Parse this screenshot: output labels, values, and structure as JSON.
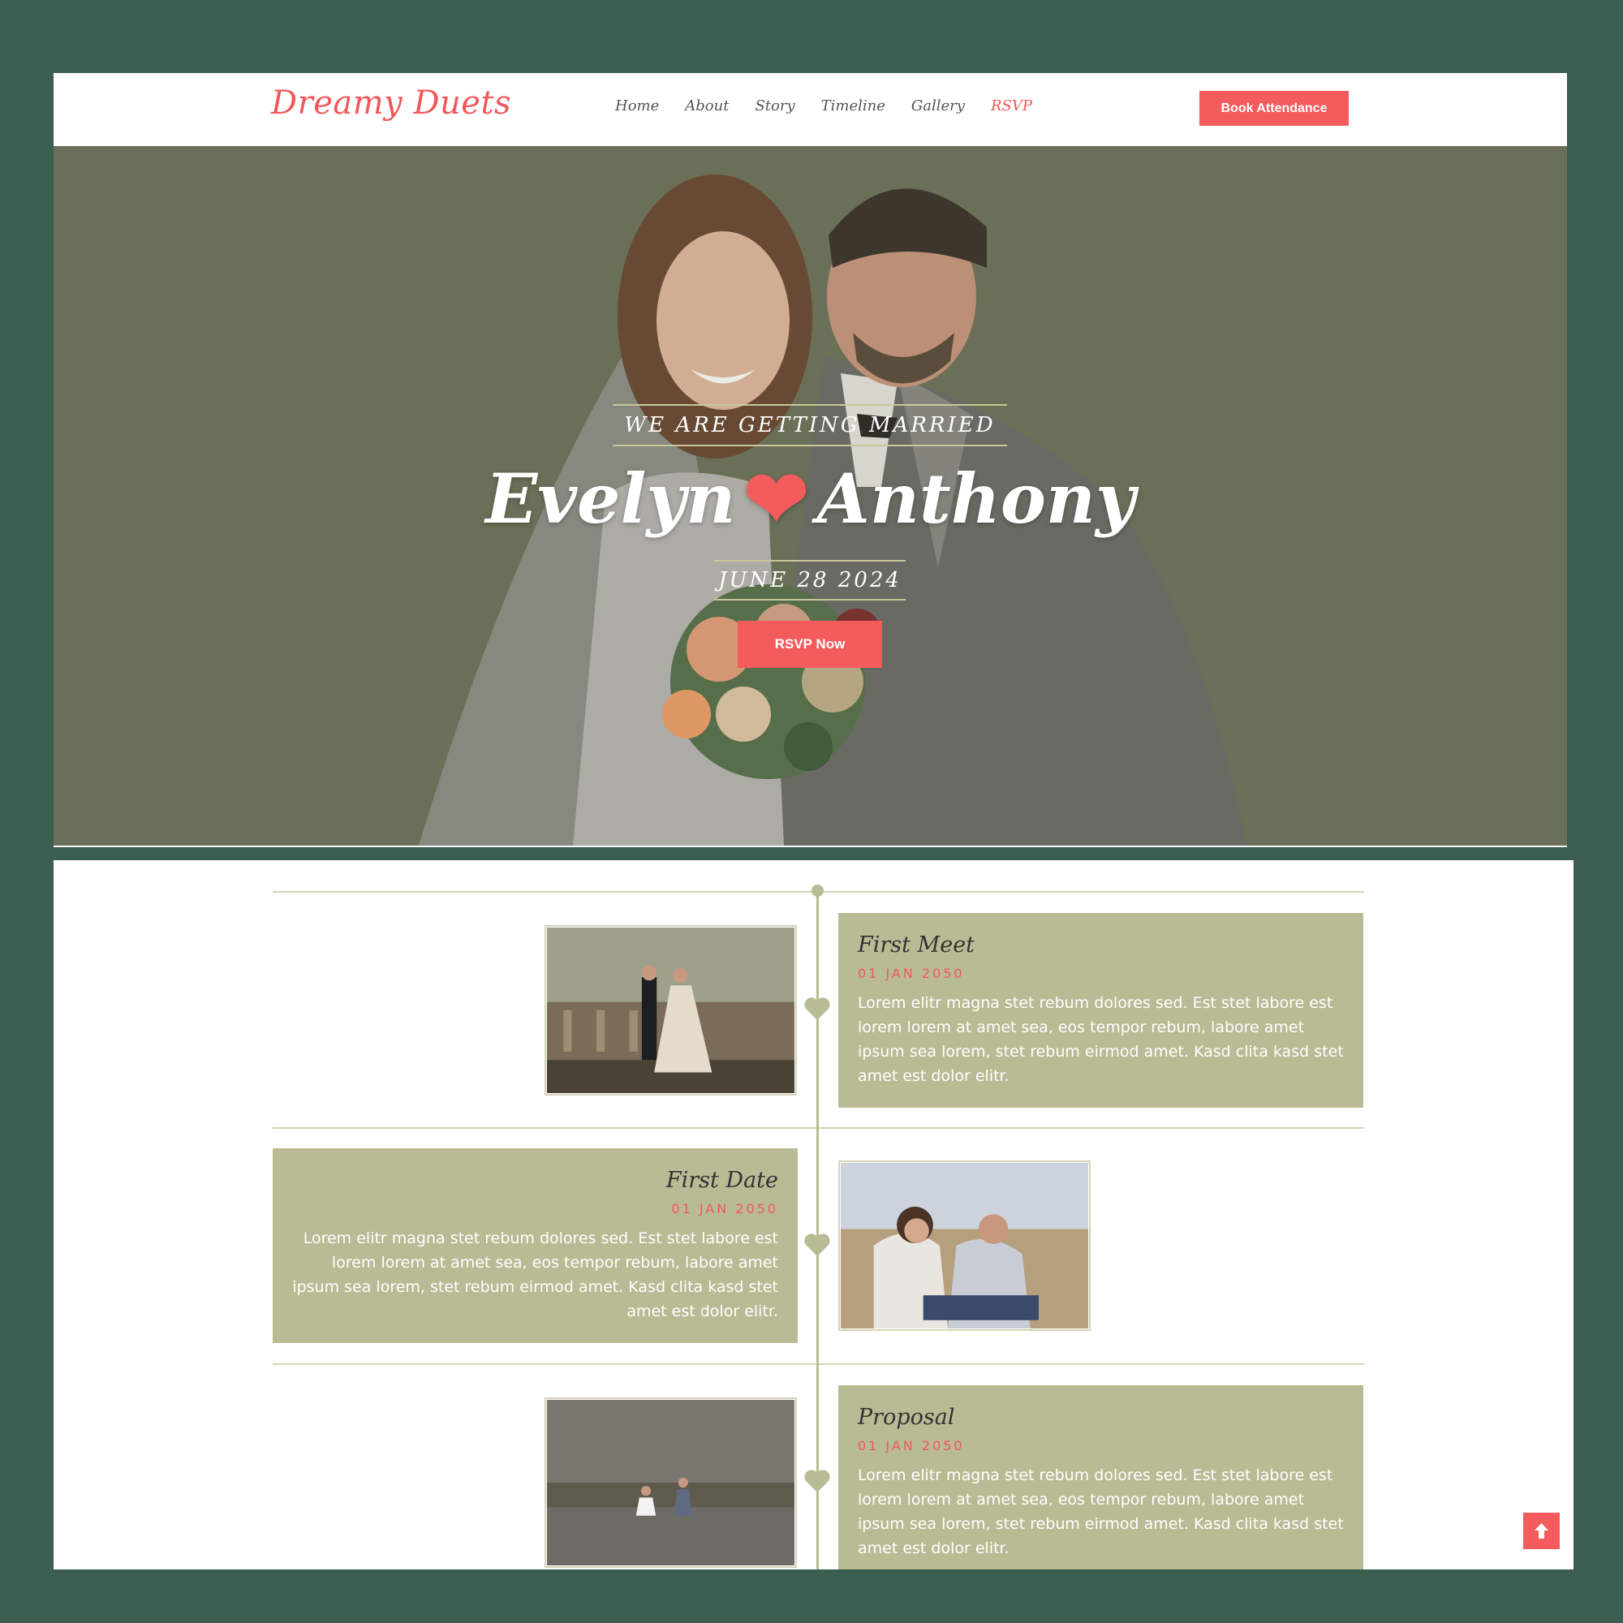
{
  "nav": {
    "logo": "Dreamy Duets",
    "menu": [
      "Home",
      "About",
      "Story",
      "Timeline",
      "Gallery",
      "RSVP"
    ],
    "active": "RSVP",
    "cta": "Book Attendance"
  },
  "hero": {
    "tagline": "WE ARE GETTING MARRIED",
    "groom_bride_left": "Evelyn",
    "groom_bride_right": "Anthony",
    "date": "JUNE 28 2024",
    "cta": "RSVP Now"
  },
  "timeline": {
    "items": [
      {
        "title": "First Meet",
        "date": "01 JAN 2050",
        "text": "Lorem elitr magna stet rebum dolores sed. Est stet labore est lorem lorem at amet sea, eos tempor rebum, labore amet ipsum sea lorem, stet rebum eirmod amet. Kasd clita kasd stet amet est dolor elitr."
      },
      {
        "title": "First Date",
        "date": "01 JAN 2050",
        "text": "Lorem elitr magna stet rebum dolores sed. Est stet labore est lorem lorem at amet sea, eos tempor rebum, labore amet ipsum sea lorem, stet rebum eirmod amet. Kasd clita kasd stet amet est dolor elitr."
      },
      {
        "title": "Proposal",
        "date": "01 JAN 2050",
        "text": "Lorem elitr magna stet rebum dolores sed. Est stet labore est lorem lorem at amet sea, eos tempor rebum, labore amet ipsum sea lorem, stet rebum eirmod amet. Kasd clita kasd stet amet est dolor elitr."
      }
    ]
  },
  "colors": {
    "accent": "#f45b5d",
    "olive": "#b9bb95",
    "hero_bg": "#6d715a",
    "page_bg": "#3b5e51"
  },
  "icons": {
    "heart": "heart-icon",
    "back_to_top": "arrow-up-icon"
  }
}
